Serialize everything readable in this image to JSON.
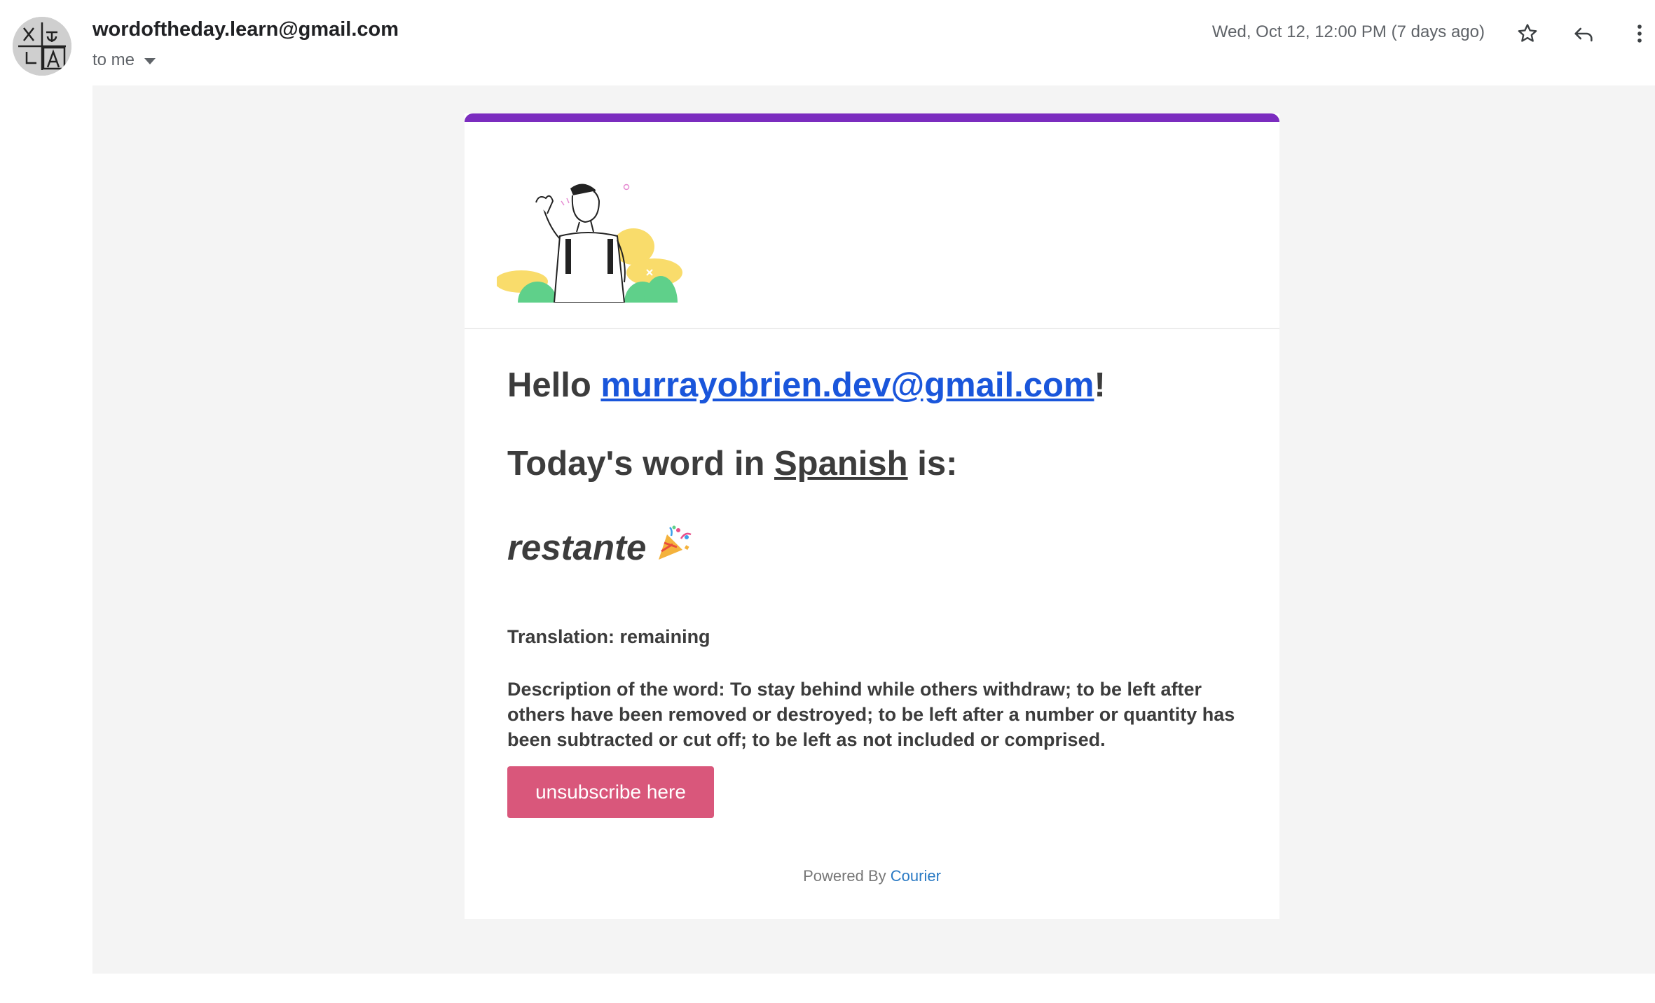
{
  "header": {
    "sender": "wordoftheday.learn@gmail.com",
    "to": "to me",
    "date": "Wed, Oct 12, 12:00 PM (7 days ago)",
    "icons": [
      "translate-avatar-icon",
      "star-icon",
      "reply-icon",
      "more-vert-icon",
      "chevron-down-icon"
    ]
  },
  "email": {
    "hello_prefix": "Hello ",
    "recipient_email": "murrayobrien.dev@gmail.com",
    "hello_suffix": "!",
    "word_intro_prefix": "Today's word in ",
    "language": "Spanish",
    "word_intro_suffix": " is:",
    "word": "restante",
    "word_emoji": "party-popper-icon",
    "translation": "Translation: remaining",
    "description": "Description of the word: To stay behind while others withdraw; to be left after others have been removed or destroyed; to be left after a number or quantity has been subtracted or cut off; to be left as not included or comprised.",
    "unsubscribe_label": "unsubscribe here",
    "powered_by": "Powered By ",
    "powered_brand": "Courier"
  },
  "colors": {
    "accent_bar": "#7b2cbf",
    "button": "#d9577b",
    "link": "#1a56db",
    "courier_link": "#2a7ac4"
  }
}
